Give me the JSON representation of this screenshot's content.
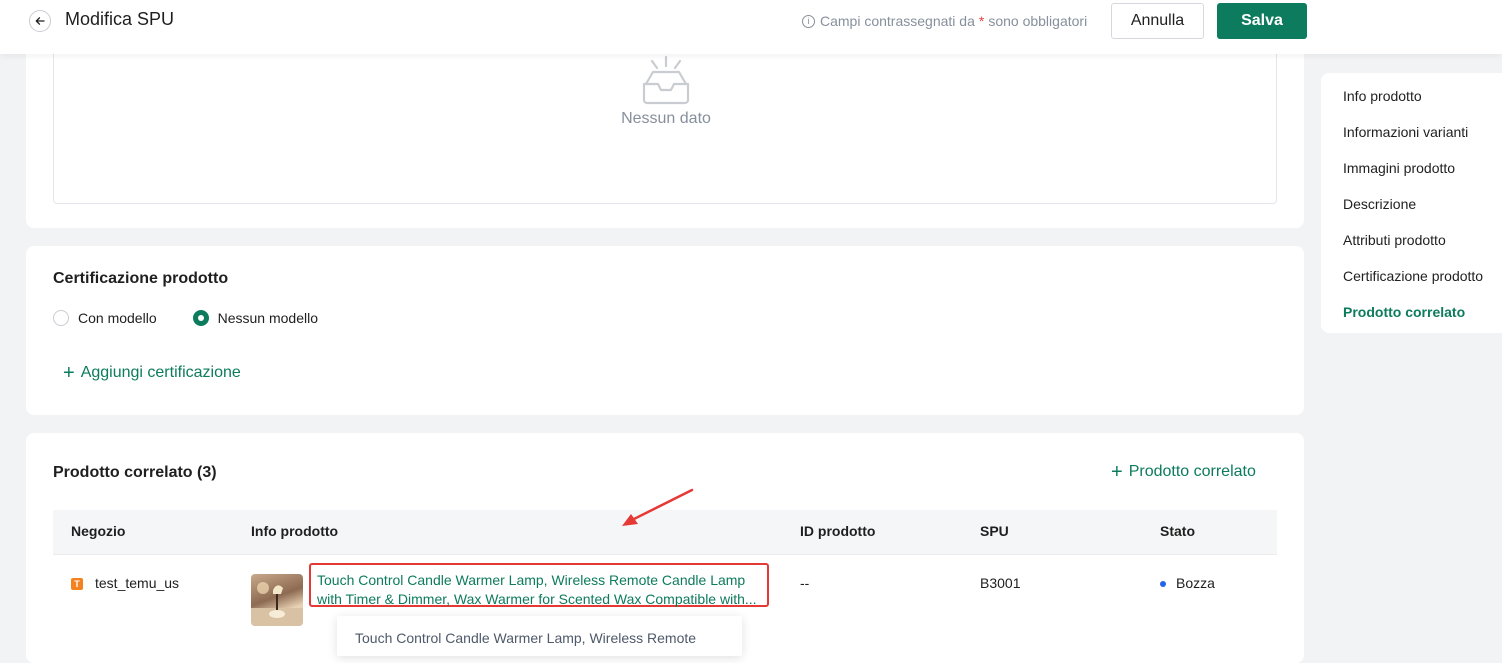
{
  "header": {
    "title": "Modifica SPU",
    "required_note_prefix": "Campi contrassegnati da",
    "required_star": "*",
    "required_note_suffix": "sono obbligatori",
    "cancel_label": "Annulla",
    "save_label": "Salva"
  },
  "empty_state": {
    "text": "Nessun dato"
  },
  "certification": {
    "title": "Certificazione prodotto",
    "options": [
      "Con modello",
      "Nessun modello"
    ],
    "selected": "Nessun modello",
    "add_label": "Aggiungi certificazione"
  },
  "related": {
    "title": "Prodotto correlato (3)",
    "add_label": "Prodotto correlato",
    "columns": [
      "Negozio",
      "Info prodotto",
      "ID prodotto",
      "SPU",
      "Stato"
    ],
    "rows": [
      {
        "shop": "test_temu_us",
        "product_line1": "Touch Control Candle Warmer Lamp, Wireless Remote Candle Lamp",
        "product_line2": "with Timer & Dimmer, Wax Warmer for Scented Wax Compatible with...",
        "product_id": "--",
        "spu": "B3001",
        "status": "Bozza"
      }
    ],
    "tooltip_text": "Touch Control Candle Warmer Lamp, Wireless Remote"
  },
  "nav": {
    "items": [
      "Info prodotto",
      "Informazioni varianti",
      "Immagini prodotto",
      "Descrizione",
      "Attributi prodotto",
      "Certificazione prodotto",
      "Prodotto correlato"
    ],
    "active": "Prodotto correlato"
  },
  "colors": {
    "primary": "#0d7b5d",
    "highlight_border": "#e53935",
    "status_draft": "#2463eb",
    "background": "#f2f3f5"
  }
}
